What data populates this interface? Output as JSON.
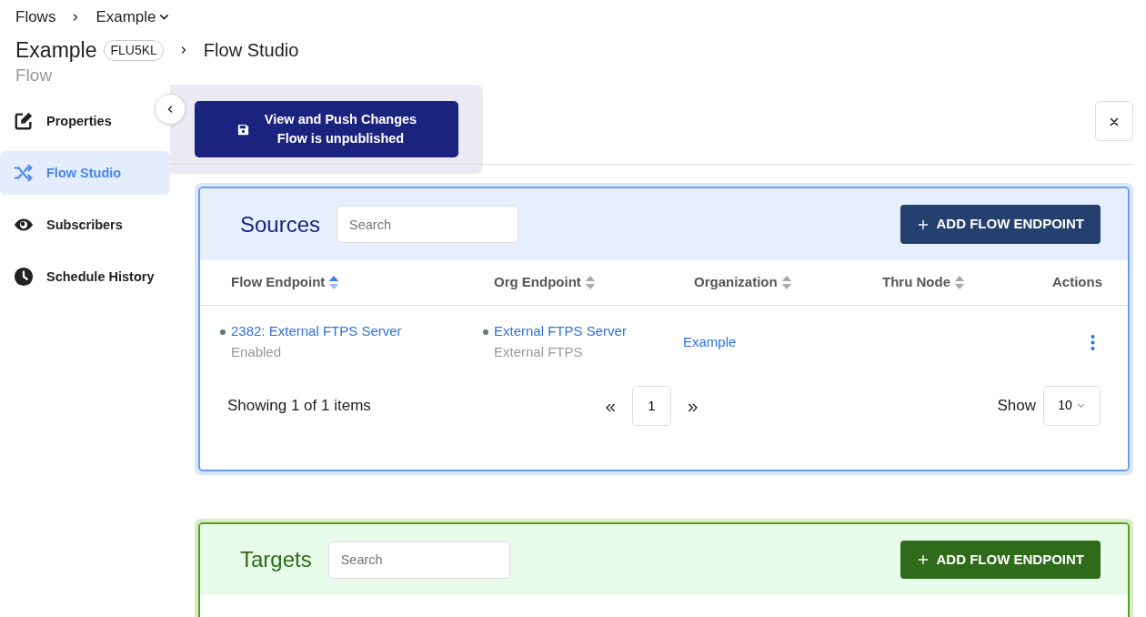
{
  "breadcrumb": {
    "items": [
      "Flows",
      "Example"
    ]
  },
  "header": {
    "title": "Example",
    "badge": "FLU5KL",
    "page": "Flow Studio",
    "subtitle": "Flow"
  },
  "sidebar": {
    "items": [
      {
        "label": "Properties",
        "selected": false
      },
      {
        "label": "Flow Studio",
        "selected": true
      },
      {
        "label": "Subscribers",
        "selected": false
      },
      {
        "label": "Schedule History",
        "selected": false
      }
    ]
  },
  "publish_button": {
    "title": "View and Push Changes",
    "subtitle": "Flow is unpublished"
  },
  "sections": [
    {
      "kind": "sources",
      "title": "Sources",
      "search": {
        "placeholder": "Search"
      },
      "add_button": "ADD FLOW ENDPOINT",
      "columns": [
        {
          "label": "Flow Endpoint",
          "sorted": true
        },
        {
          "label": "Org Endpoint",
          "sorted": false
        },
        {
          "label": "Organization",
          "sorted": false
        },
        {
          "label": "Thru Node",
          "sorted": false
        },
        {
          "label": "Actions"
        }
      ],
      "rows": [
        {
          "flow_endpoint": {
            "name": "2382: External FTPS Server",
            "status": "Enabled",
            "color": "#5f7a6e"
          },
          "org_endpoint": {
            "name": "External FTPS Server",
            "type": "External FTPS",
            "color": "#5f7a6e"
          },
          "organization": "Example"
        }
      ],
      "footer": {
        "summary": "Showing 1 of 1 items",
        "page": "1",
        "show_label": "Show",
        "page_size": "10"
      }
    },
    {
      "kind": "targets",
      "title": "Targets",
      "search": {
        "placeholder": "Search"
      },
      "add_button": "ADD FLOW ENDPOINT"
    }
  ]
}
